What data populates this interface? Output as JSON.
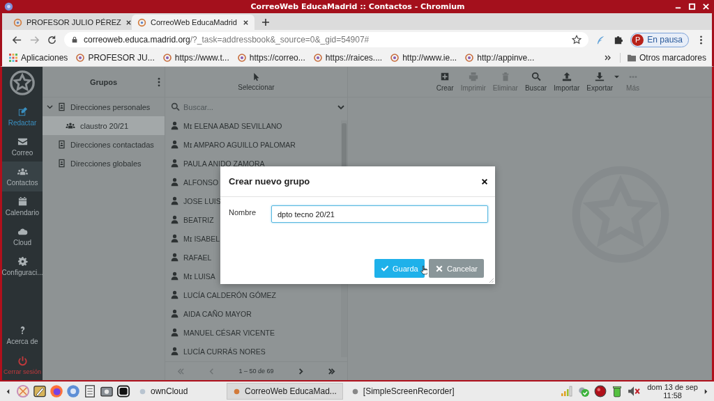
{
  "window": {
    "title": "CorreoWeb EducaMadrid :: Contactos - Chromium"
  },
  "tabs": [
    {
      "label": "PROFESOR JULIO PÉREZ",
      "selected": false
    },
    {
      "label": "CorreoWeb EducaMadrid",
      "selected": true
    }
  ],
  "address_bar": {
    "url_host": "correoweb.educa.madrid.org",
    "url_path": "/?_task=addressbook&_source=0&_gid=54907#"
  },
  "profile": {
    "initial": "P",
    "status": "En pausa"
  },
  "bookmarks": [
    {
      "label": "Aplicaciones",
      "kind": "apps"
    },
    {
      "label": "PROFESOR JU...",
      "kind": "site"
    },
    {
      "label": "https://www.t...",
      "kind": "site"
    },
    {
      "label": "https://correo...",
      "kind": "site"
    },
    {
      "label": "https://raices....",
      "kind": "site"
    },
    {
      "label": "http://www.ie...",
      "kind": "site"
    },
    {
      "label": "http://appinve...",
      "kind": "site"
    }
  ],
  "bookmarks_more": {
    "label": "Otros marcadores"
  },
  "nav": [
    {
      "label": "Redactar",
      "kind": "compose",
      "selected": false
    },
    {
      "label": "Correo",
      "kind": "mail",
      "selected": false
    },
    {
      "label": "Contactos",
      "kind": "contacts",
      "selected": true
    },
    {
      "label": "Calendario",
      "kind": "calendar",
      "selected": false
    },
    {
      "label": "Cloud",
      "kind": "cloud",
      "selected": false
    },
    {
      "label": "Configuraci...",
      "kind": "settings",
      "selected": false
    }
  ],
  "nav_bottom": [
    {
      "label": "Acerca de",
      "kind": "about",
      "selected": false
    },
    {
      "label": "Cerrar sesión",
      "kind": "logout",
      "selected": false
    }
  ],
  "groups": {
    "title": "Grupos",
    "tree": [
      {
        "label": "Direcciones personales",
        "expanded": true,
        "selected": false,
        "children": [
          {
            "label": "claustro 20/21",
            "selected": true
          }
        ]
      },
      {
        "label": "Direcciones contactadas",
        "selected": false
      },
      {
        "label": "Direcciones globales",
        "selected": false
      }
    ]
  },
  "list_toolbar": {
    "label": "Seleccionar"
  },
  "search": {
    "placeholder": "Buscar..."
  },
  "contacts": [
    "Mɪ ELENA ABAD SEVILLANO",
    "Mɪ AMPARO AGUILLO PALOMAR",
    "PAULA ANIDO ZAMORA",
    "ALFONSO",
    "JOSE LUIS",
    "BEATRIZ",
    "Mɪ ISABEL",
    "RAFAEL",
    "Mɪ LUISA",
    "LUCÍA CALDERÓN GÓMEZ",
    "AIDA CAÑO MAYOR",
    "MANUEL CÉSAR VICENTE",
    "LUCÍA CURRÁS NORES"
  ],
  "pager": {
    "text": "1 – 50 de 69"
  },
  "toolbar": [
    {
      "label": "Crear",
      "kind": "create",
      "disabled": false
    },
    {
      "label": "Imprimir",
      "kind": "print",
      "disabled": true
    },
    {
      "label": "Eliminar",
      "kind": "delete",
      "disabled": true
    },
    {
      "label": "Buscar",
      "kind": "search",
      "disabled": false
    },
    {
      "label": "Importar",
      "kind": "import",
      "disabled": false
    },
    {
      "label": "Exportar",
      "kind": "export",
      "disabled": false
    },
    {
      "label": "Más",
      "kind": "more",
      "disabled": true
    }
  ],
  "dialog": {
    "title": "Crear nuevo grupo",
    "field_label": "Nombre",
    "value": "dpto tecno 20/21",
    "buttons": [
      {
        "label": "Guarda",
        "kind": "save"
      },
      {
        "label": "Cancelar",
        "kind": "cancel"
      }
    ]
  },
  "taskbar": {
    "windows": [
      {
        "label": "ownCloud",
        "selected": false
      },
      {
        "label": "CorreoWeb EducaMad...",
        "selected": true
      },
      {
        "label": "[SimpleScreenRecorder]",
        "selected": false
      }
    ],
    "date": "dom 13 de sep",
    "time": "11:58"
  }
}
